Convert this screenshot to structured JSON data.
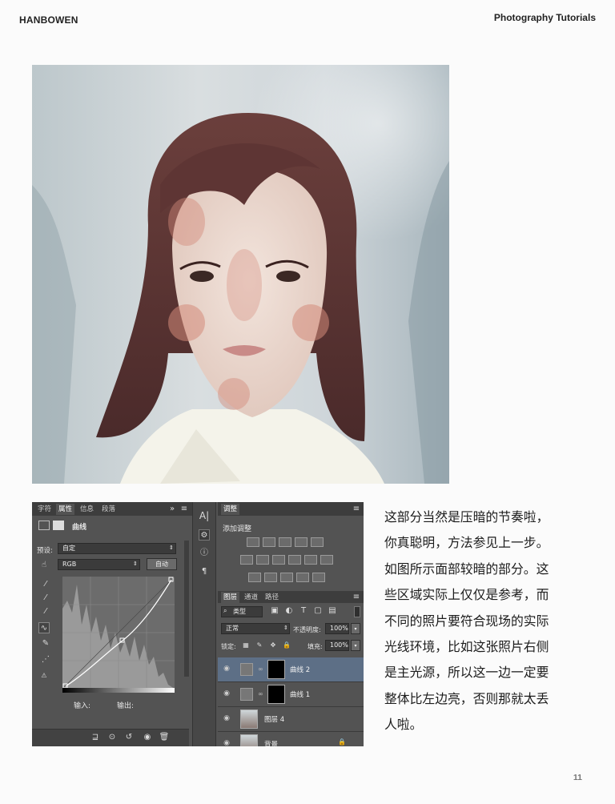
{
  "header": {
    "brand": "HANBOWEN",
    "section": "Photography Tutorials"
  },
  "photoshop": {
    "properties_panel": {
      "tabs": [
        "字符",
        "属性",
        "信息",
        "段落"
      ],
      "active_tab": "属性",
      "panel_title": "曲线",
      "preset_label": "预设:",
      "preset_value": "自定",
      "channel_value": "RGB",
      "auto_button": "自动",
      "input_label": "输入:",
      "output_label": "输出:"
    },
    "adjustments_panel": {
      "tab": "调整",
      "subtitle": "添加调整"
    },
    "layers_panel": {
      "tabs": [
        "图层",
        "通道",
        "路径"
      ],
      "filter_label": "类型",
      "blend_mode": "正常",
      "opacity_label": "不透明度:",
      "opacity_value": "100%",
      "lock_label": "锁定:",
      "fill_label": "填充:",
      "fill_value": "100%",
      "layers": [
        {
          "name": "曲线 2",
          "selected": true
        },
        {
          "name": "曲线 1",
          "selected": false
        },
        {
          "name": "图层 4",
          "selected": false
        },
        {
          "name": "背景",
          "selected": false
        }
      ]
    }
  },
  "body_text": [
    "这部分当然是压暗的节奏啦，",
    "你真聪明，方法参见上一步。",
    "如图所示面部较暗的部分。这",
    "些区域实际上仅仅是参考，而",
    "不同的照片要符合现场的实际",
    "光线环境，比如这张照片右侧",
    "是主光源，所以这一边一定要",
    "整体比左边亮，否则那就太丢",
    "人啦。"
  ],
  "page_number": "11"
}
